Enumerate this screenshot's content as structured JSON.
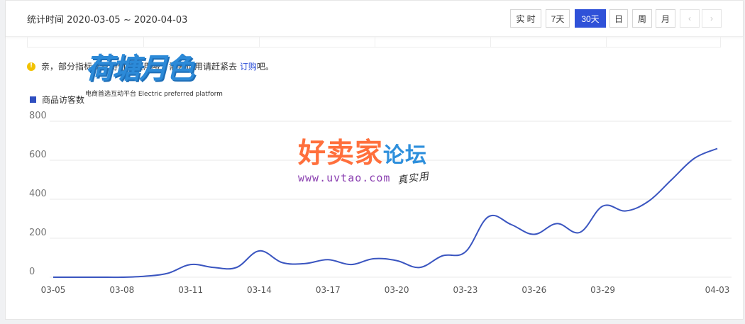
{
  "header": {
    "stat_range": "统计时间 2020-03-05 ~ 2020-04-03",
    "buttons": [
      {
        "label": "实 时",
        "active": false,
        "disabled": false
      },
      {
        "label": "7天",
        "active": false,
        "disabled": false
      },
      {
        "label": "30天",
        "active": true,
        "disabled": false
      },
      {
        "label": "日",
        "active": false,
        "disabled": false
      },
      {
        "label": "周",
        "active": false,
        "disabled": false
      },
      {
        "label": "月",
        "active": false,
        "disabled": false
      },
      {
        "label": "‹",
        "active": false,
        "disabled": true
      },
      {
        "label": "›",
        "active": false,
        "disabled": true
      }
    ]
  },
  "notice": {
    "icon": "!",
    "text_before": "亲，部分指标仅支持",
    "text_middle": "付费使用哦，需要使用请赶紧去",
    "link": "订购",
    "text_after": "吧。"
  },
  "watermarks": {
    "logo1": "荷塘月色",
    "logo1_sub": "电商首选互动平台 Electric preferred platform",
    "logo2_main": "好卖家",
    "logo2_accent": "论坛",
    "logo2_url": "www.uvtao.com",
    "logo2_hand": "真实用"
  },
  "colors": {
    "accent": "#2f51d8",
    "series": "#3a55c0",
    "grid": "#e8e8e8",
    "axis_text": "#666666"
  },
  "chart_data": {
    "type": "line",
    "legend": {
      "position": "top-left"
    },
    "grid": true,
    "x": [
      "03-05",
      "03-06",
      "03-07",
      "03-08",
      "03-09",
      "03-10",
      "03-11",
      "03-12",
      "03-13",
      "03-14",
      "03-15",
      "03-16",
      "03-17",
      "03-18",
      "03-19",
      "03-20",
      "03-21",
      "03-22",
      "03-23",
      "03-24",
      "03-25",
      "03-26",
      "03-27",
      "03-28",
      "03-29",
      "03-30",
      "03-31",
      "04-01",
      "04-02",
      "04-03"
    ],
    "x_ticks": [
      "03-05",
      "03-08",
      "03-11",
      "03-14",
      "03-17",
      "03-20",
      "03-23",
      "03-26",
      "03-29",
      "04-03"
    ],
    "ylim": [
      0,
      800
    ],
    "y_ticks": [
      0,
      200,
      400,
      600,
      800
    ],
    "series": [
      {
        "name": "商品访客数",
        "values": [
          0,
          0,
          0,
          0,
          5,
          20,
          65,
          50,
          50,
          135,
          75,
          70,
          90,
          65,
          95,
          85,
          50,
          110,
          130,
          310,
          270,
          220,
          275,
          230,
          365,
          340,
          390,
          500,
          610,
          660
        ]
      }
    ]
  }
}
